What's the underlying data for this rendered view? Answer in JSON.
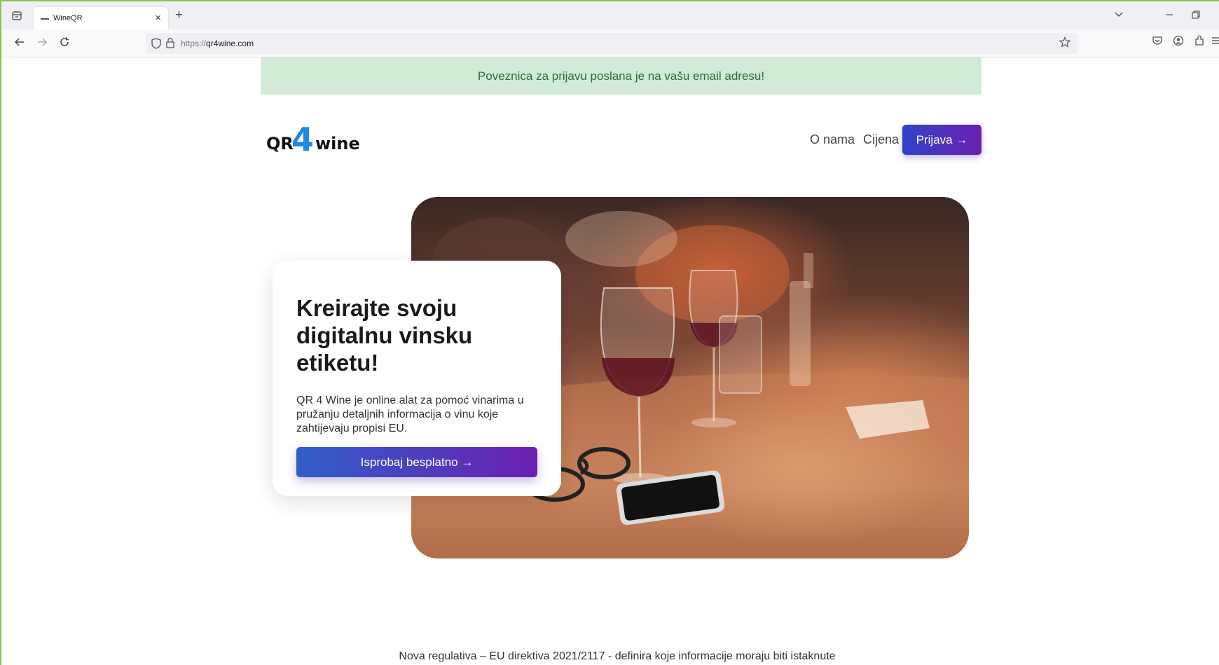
{
  "browser": {
    "tab_title": "WineQR",
    "tab_close": "×",
    "new_tab": "+",
    "url_protocol": "https://",
    "url_host": "qr4wine.com",
    "icons": [
      "tab-list-icon",
      "back-icon",
      "forward-icon",
      "reload-icon",
      "shield-icon",
      "lock-icon",
      "star-icon",
      "pocket-icon",
      "account-icon",
      "extensions-icon",
      "menu-icon",
      "minimize-icon",
      "restore-icon",
      "chevron-down-icon"
    ]
  },
  "alert": {
    "message": "Poveznica za prijavu poslana je na vašu email adresu!"
  },
  "header": {
    "logo_qr": "QR",
    "logo_four": "4",
    "logo_wine": "wine",
    "nav_about": "O nama",
    "nav_price": "Cijena",
    "login_label": "Prijava →"
  },
  "hero": {
    "title": "Kreirajte svoju digitalnu vinsku etiketu!",
    "description": "QR 4 Wine je online alat za pomoć vinarima u pružanju detaljnih informacija o vinu koje zahtijevaju propisi EU.",
    "cta_label": "Isprobaj besplatno →"
  },
  "footer": {
    "note": "Nova regulativa – EU direktiva 2021/2117 - definira koje informacije moraju biti istaknute"
  },
  "colors": {
    "alert_bg": "#d1ebd6",
    "alert_text": "#2e6b3a",
    "button_gradient_start": "#2f43c9",
    "button_gradient_end": "#6b1fb0",
    "logo_accent": "#1e88e5"
  }
}
